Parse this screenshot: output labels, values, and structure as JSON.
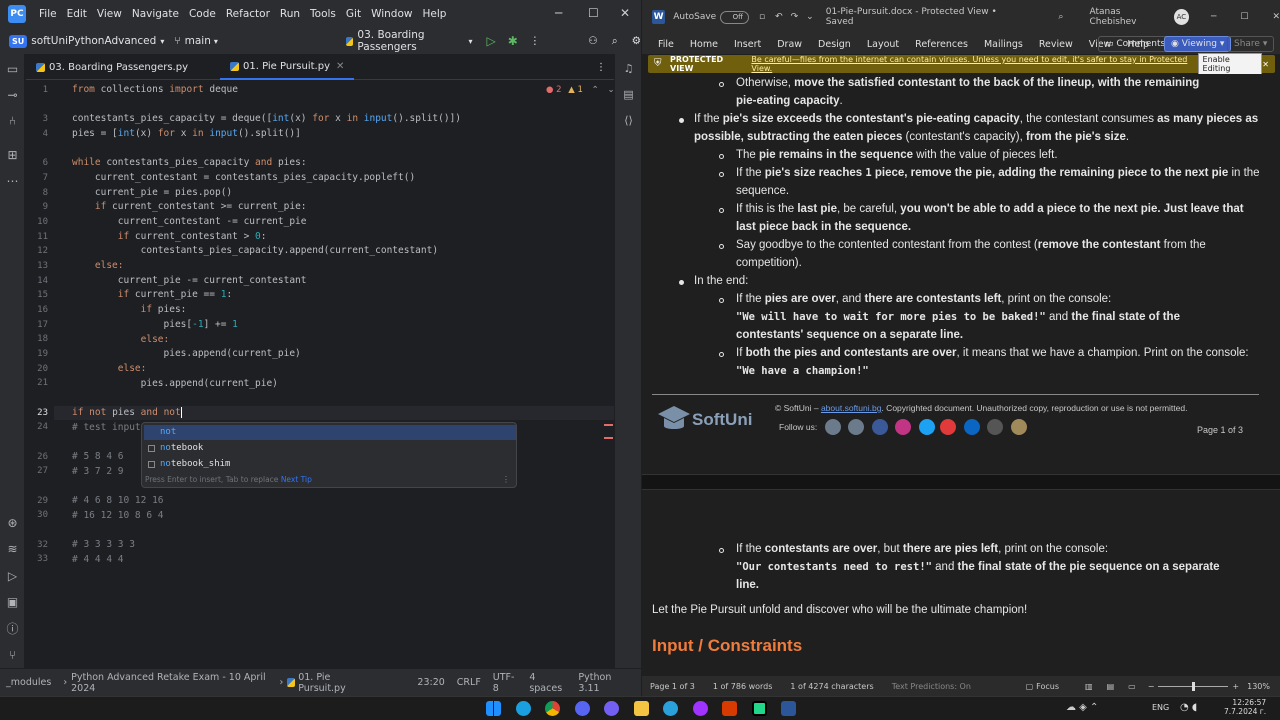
{
  "ide": {
    "menu": [
      "File",
      "Edit",
      "View",
      "Navigate",
      "Code",
      "Refactor",
      "Run",
      "Tools",
      "Git",
      "Window",
      "Help"
    ],
    "project_badge": "SU",
    "project": "softUniPythonAdvanced",
    "branch": "main",
    "run_config": "03. Boarding Passengers",
    "tabs": [
      {
        "label": "03. Boarding Passengers.py"
      },
      {
        "label": "01. Pie Pursuit.py"
      }
    ],
    "inspection": {
      "errors": "2",
      "warnings": "1"
    },
    "line_numbers": [
      "1",
      "",
      "3",
      "4",
      "",
      "6",
      "7",
      "8",
      "9",
      "10",
      "11",
      "12",
      "13",
      "14",
      "15",
      "16",
      "17",
      "18",
      "19",
      "20",
      "21",
      "",
      "23",
      "24",
      "",
      "26",
      "27",
      "",
      "29",
      "30",
      "",
      "32",
      "33"
    ],
    "code": {
      "l1": [
        "from",
        "collections",
        "import",
        "deque"
      ],
      "l3a": "contestants_pies_capacity = deque([",
      "l3b": "int",
      "l3c": "(x) ",
      "l3d": "for",
      "l3e": " x ",
      "l3f": "in",
      "l3g": " input",
      "l3h": "().split()])",
      "l4a": "pies = [",
      "l4b": "int",
      "l4c": "(x) ",
      "l4d": "for",
      "l4e": " x ",
      "l4f": "in",
      "l4g": " input",
      "l4h": "().split()]",
      "l6a": "while",
      "l6b": " contestants_pies_capacity ",
      "l6c": "and",
      "l6d": " pies:",
      "l7": "    current_contestant = contestants_pies_capacity.popleft()",
      "l8": "    current_pie = pies.pop()",
      "l9a": "    if",
      "l9b": " current_contestant >= current_pie:",
      "l10": "        current_contestant -= current_pie",
      "l11a": "        if",
      "l11b": " current_contestant > ",
      "l11c": "0",
      "l11d": ":",
      "l12": "            contestants_pies_capacity.append(current_contestant)",
      "l13": "    else:",
      "l14": "        current_pie -= current_contestant",
      "l15a": "        if",
      "l15b": " current_pie == ",
      "l15c": "1",
      "l15d": ":",
      "l16a": "            if",
      "l16b": " pies:",
      "l17a": "                pies[",
      "l17b": "-1",
      "l17c": "] += ",
      "l17d": "1",
      "l18": "            else:",
      "l19": "                pies.append(current_pie)",
      "l20": "        else:",
      "l21": "            pies.append(current_pie)",
      "l23a": "if",
      "l23b": " not",
      "l23c": " pies ",
      "l23d": "and",
      "l23e": " not",
      "l24": "# test input",
      "l26": "# 5 8 4 6",
      "l27": "# 3 7 2 9",
      "l29": "# 4 6 8 10 12 16",
      "l30": "# 16 12 10 8 6 4",
      "l32": "# 3 3 3 3 3",
      "l33": "# 4 4 4 4"
    },
    "completion": {
      "items": [
        {
          "match": "not",
          "rest": ""
        },
        {
          "match": "no",
          "rest": "tebook"
        },
        {
          "match": "no",
          "rest": "tebook_shim"
        }
      ],
      "hint": "Press Enter to insert, Tab to replace",
      "hint_link": "Next Tip"
    },
    "status": {
      "path1": "_modules",
      "path2": "Python Advanced Retake Exam - 10 April 2024",
      "file": "01. Pie Pursuit.py",
      "position": "23:20",
      "line_sep": "CRLF",
      "encoding": "UTF-8",
      "indent": "4 spaces",
      "interpreter": "Python 3.11"
    }
  },
  "word": {
    "autosave_label": "AutoSave",
    "autosave_state": "Off",
    "doc_title": "01-Pie-Pursuit.docx  -  Protected View  •  Saved",
    "user": "Atanas Chebishev",
    "user_initials": "AC",
    "ribbon": [
      "File",
      "Home",
      "Insert",
      "Draw",
      "Design",
      "Layout",
      "References",
      "Mailings",
      "Review",
      "View",
      "Help"
    ],
    "comments_btn": "Comments",
    "viewing_btn": "Viewing",
    "share_btn": "Share",
    "protected": {
      "label": "PROTECTED VIEW",
      "message": "Be careful—files from the internet can contain viruses. Unless you need to edit, it's safer to stay in Protected View.",
      "button": "Enable Editing"
    },
    "body": {
      "p1a": "Otherwise, ",
      "p1b": "move the satisfied contestant to the back of the lineup, with the remaining",
      "p1c": "pie-eating capacity",
      "p1d": ".",
      "p2a": "If the ",
      "p2b": "pie's size exceeds the contestant's pie-eating capacity",
      "p2c": ", the contestant consumes ",
      "p2d": "as many pieces as",
      "p2e": "possible, subtracting the eaten pieces",
      "p2f": " (contestant's capacity), ",
      "p2g": "from the pie's size",
      "p2h": ".",
      "p3a": "The ",
      "p3b": "pie remains in the sequence",
      "p3c": " with the value of pieces left.",
      "p4a": "If the ",
      "p4b": "pie's size reaches ",
      "p4c": "1",
      "p4d": " piece, remove the pie, adding the remaining piece to the next pie",
      "p4e": " in the",
      "p4f": "sequence.",
      "p5a": "If this is the ",
      "p5b": "last pie",
      "p5c": ", be careful, ",
      "p5d": "you won't be able to add a piece to the next pie. Just leave that",
      "p5e": "last piece back in the sequence.",
      "p6a": "Say goodbye to the contented contestant from the contest (",
      "p6b": "remove the contestant",
      "p6c": " from the",
      "p6d": "competition).",
      "p7": "In the end:",
      "p8a": "If the ",
      "p8b": "pies are over",
      "p8c": ", and ",
      "p8d": "there are contestants left",
      "p8e": ", print on the console:",
      "p8f": "\"We will have to wait for more pies to be baked!\"",
      "p8g": " and ",
      "p8h": "the final state of the",
      "p8i": "contestants' sequence on a separate line.",
      "p9a": "If ",
      "p9b": "both the pies and contestants are over",
      "p9c": ", it means that we have a champion. Print on the console:",
      "p9d": "\"We have a champion!\"",
      "footer_a": "© SoftUni – ",
      "footer_link": "about.softuni.bg",
      "footer_b": ". Copyrighted document. Unauthorized copy, reproduction or use is not permitted.",
      "follow": "Follow us:",
      "softuni": "SoftUni",
      "page_of": "Page 1 of 3",
      "p10a": "If the ",
      "p10b": "contestants are over",
      "p10c": ", but ",
      "p10d": "there are pies left",
      "p10e": ", print on the console:",
      "p10f": "\"Our contestants need to rest!\"",
      "p10g": " and ",
      "p10h": "the final state of the pie sequence on a separate",
      "p10i": "line.",
      "p11": "Let the Pie Pursuit unfold and discover who will be the ultimate champion!",
      "heading": "Input / Constraints"
    },
    "status": {
      "page": "Page 1 of 3",
      "words": "1 of 786 words",
      "chars": "1 of 4274 characters",
      "predictions": "Text Predictions: On",
      "focus": "Focus",
      "zoom": "130%"
    }
  },
  "taskbar": {
    "lang": "ENG",
    "time": "12:26:57",
    "date": "7.7.2024 г."
  },
  "colors": {
    "ide_bg": "#1e1f22",
    "keyword": "#cf8e6d",
    "number": "#2aacb8",
    "accent": "#3574f0",
    "heading": "#f07c3c"
  }
}
